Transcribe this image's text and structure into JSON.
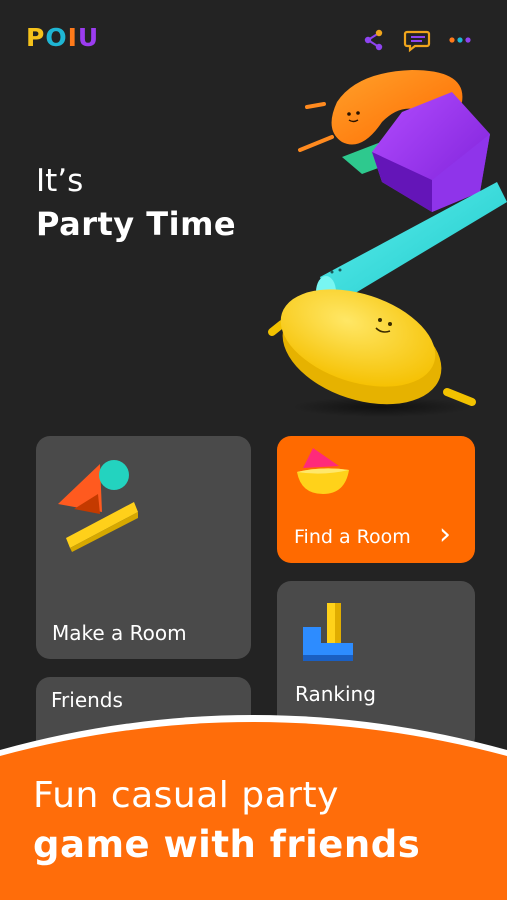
{
  "app": {
    "logo": [
      "P",
      "O",
      "I",
      "U"
    ],
    "logo_colors": [
      "#f5c21b",
      "#1fb6d4",
      "#ff7a1a",
      "#9b3cf0"
    ]
  },
  "header_icons": [
    "share-icon",
    "chat-icon",
    "more-icon"
  ],
  "hero": {
    "line1": "It’s",
    "line2": "Party Time"
  },
  "cards": {
    "make_room": "Make a Room",
    "find_room": "Find a Room",
    "find_room_chevron": "›",
    "friends": "Friends",
    "ranking": "Ranking"
  },
  "banner": {
    "line1": "Fun casual party",
    "line2": "game with friends"
  },
  "colors": {
    "background": "#232323",
    "card": "#4a4a4a",
    "accent_orange": "#ff6a00",
    "banner_orange": "#ff6d0a"
  }
}
